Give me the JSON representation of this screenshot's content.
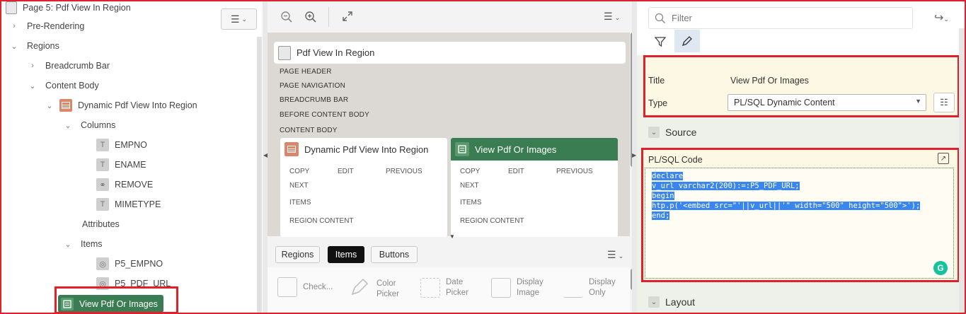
{
  "tree": {
    "page_title": "Page 5: Pdf View In Region",
    "nodes": [
      {
        "label": "Pre-Rendering"
      },
      {
        "label": "Regions"
      },
      {
        "label": "Breadcrumb Bar"
      },
      {
        "label": "Content Body"
      },
      {
        "label": "Dynamic Pdf View Into Region"
      },
      {
        "label": "Columns"
      },
      {
        "label": "EMPNO"
      },
      {
        "label": "ENAME"
      },
      {
        "label": "REMOVE"
      },
      {
        "label": "MIMETYPE"
      },
      {
        "label": "Attributes"
      },
      {
        "label": "Items"
      },
      {
        "label": "P5_EMPNO"
      },
      {
        "label": "P5_PDF_URL"
      }
    ],
    "selected": "View Pdf Or Images"
  },
  "layout": {
    "page_title": "Pdf View In Region",
    "positions": [
      "PAGE HEADER",
      "PAGE NAVIGATION",
      "BREADCRUMB BAR",
      "BEFORE CONTENT BODY",
      "CONTENT BODY"
    ],
    "regions": [
      {
        "title": "Dynamic Pdf View Into Region",
        "slots": [
          "COPY",
          "EDIT",
          "PREVIOUS",
          "NEXT",
          "ITEMS",
          "REGION CONTENT"
        ]
      },
      {
        "title": "View Pdf Or Images",
        "slots": [
          "COPY",
          "EDIT",
          "PREVIOUS",
          "NEXT",
          "ITEMS",
          "REGION CONTENT"
        ]
      }
    ]
  },
  "gallery": {
    "tabs": [
      "Regions",
      "Items",
      "Buttons"
    ],
    "active_tab": "Items",
    "items": [
      {
        "label1": "Check...",
        "label2": ""
      },
      {
        "label1": "Color",
        "label2": "Picker"
      },
      {
        "label1": "Date",
        "label2": "Picker"
      },
      {
        "label1": "Display",
        "label2": "Image"
      },
      {
        "label1": "Display",
        "label2": "Only"
      }
    ]
  },
  "props": {
    "filter_placeholder": "Filter",
    "title_label": "Title",
    "title_value": "View Pdf Or Images",
    "type_label": "Type",
    "type_value": "PL/SQL Dynamic Content",
    "source_heading": "Source",
    "code_label": "PL/SQL Code",
    "code_lines": [
      "declare",
      "v_url varchar2(200):=:P5_PDF_URL;",
      "begin",
      "htp.p('<embed src=\"'||v_url||'\" width=\"500\" height=\"500\">');",
      "end;"
    ],
    "layout_heading": "Layout"
  },
  "colors": {
    "highlight_red": "#e0202a",
    "green_region": "#3b7d52",
    "attribute_bg": "#fcf8e3"
  }
}
